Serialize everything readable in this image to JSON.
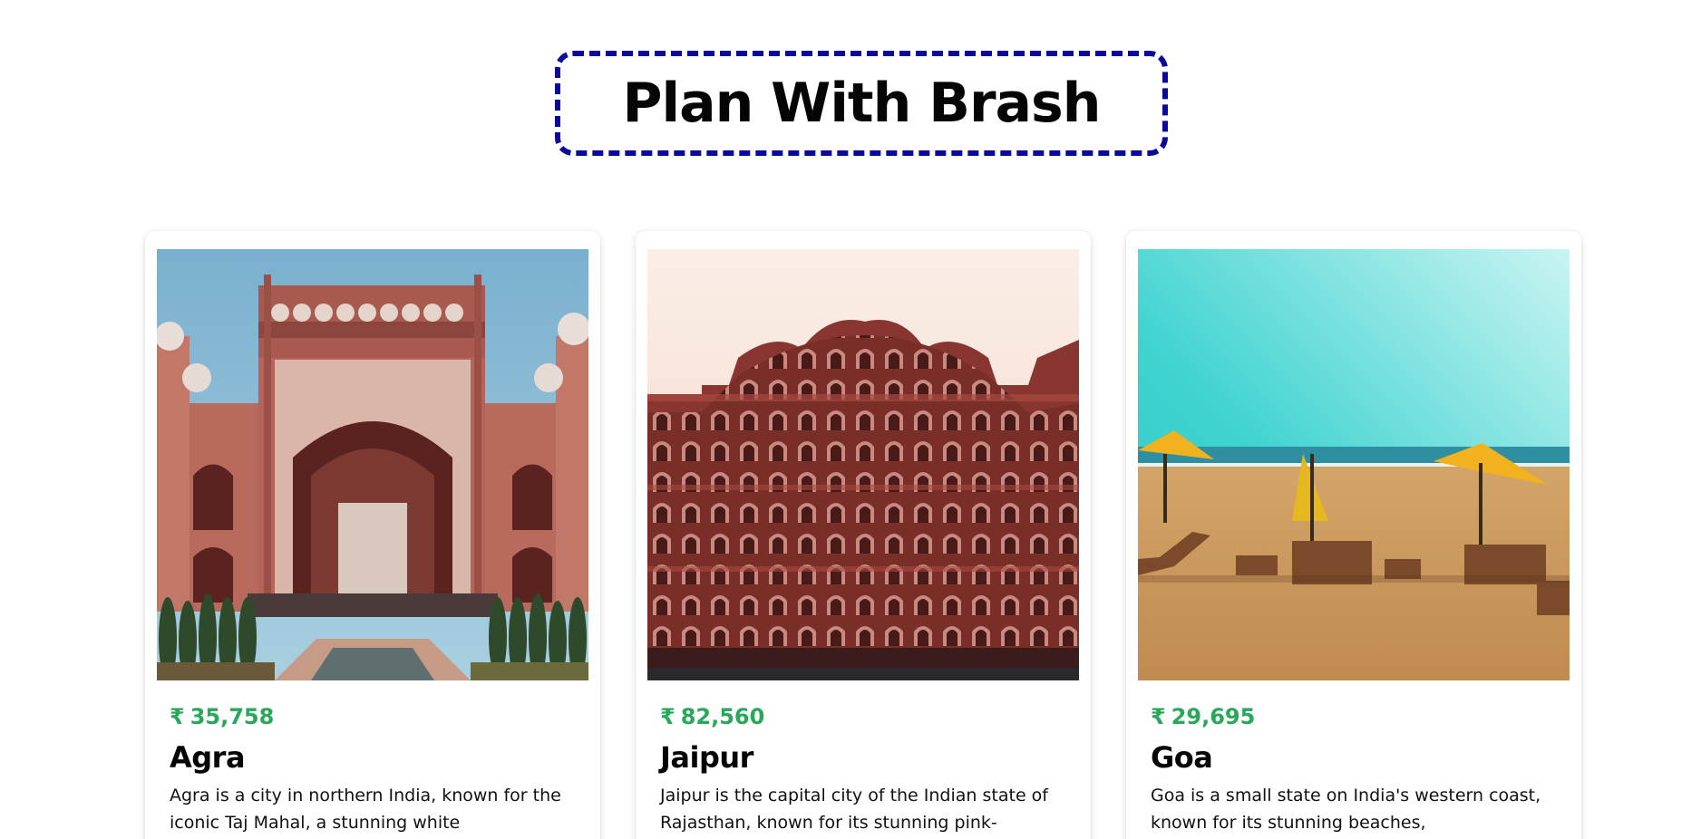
{
  "header": {
    "title": "Plan With Brash",
    "border_color": "#0a0a9a"
  },
  "cards": [
    {
      "currency_symbol": "₹",
      "price": "35,758",
      "name": "Agra",
      "description": "Agra is a city in northern India, known for the iconic Taj Mahal, a stunning white",
      "image": "taj-mahal-gate-photo"
    },
    {
      "currency_symbol": "₹",
      "price": "82,560",
      "name": "Jaipur",
      "description": "Jaipur is the capital city of the Indian state of Rajasthan, known for its stunning pink-",
      "image": "hawa-mahal-photo"
    },
    {
      "currency_symbol": "₹",
      "price": "29,695",
      "name": "Goa",
      "description": "Goa is a small state on India's western coast, known for its stunning beaches,",
      "image": "goa-beach-photo"
    }
  ],
  "colors": {
    "price": "#27a85b",
    "text": "#050505",
    "background": "#ffffff"
  }
}
